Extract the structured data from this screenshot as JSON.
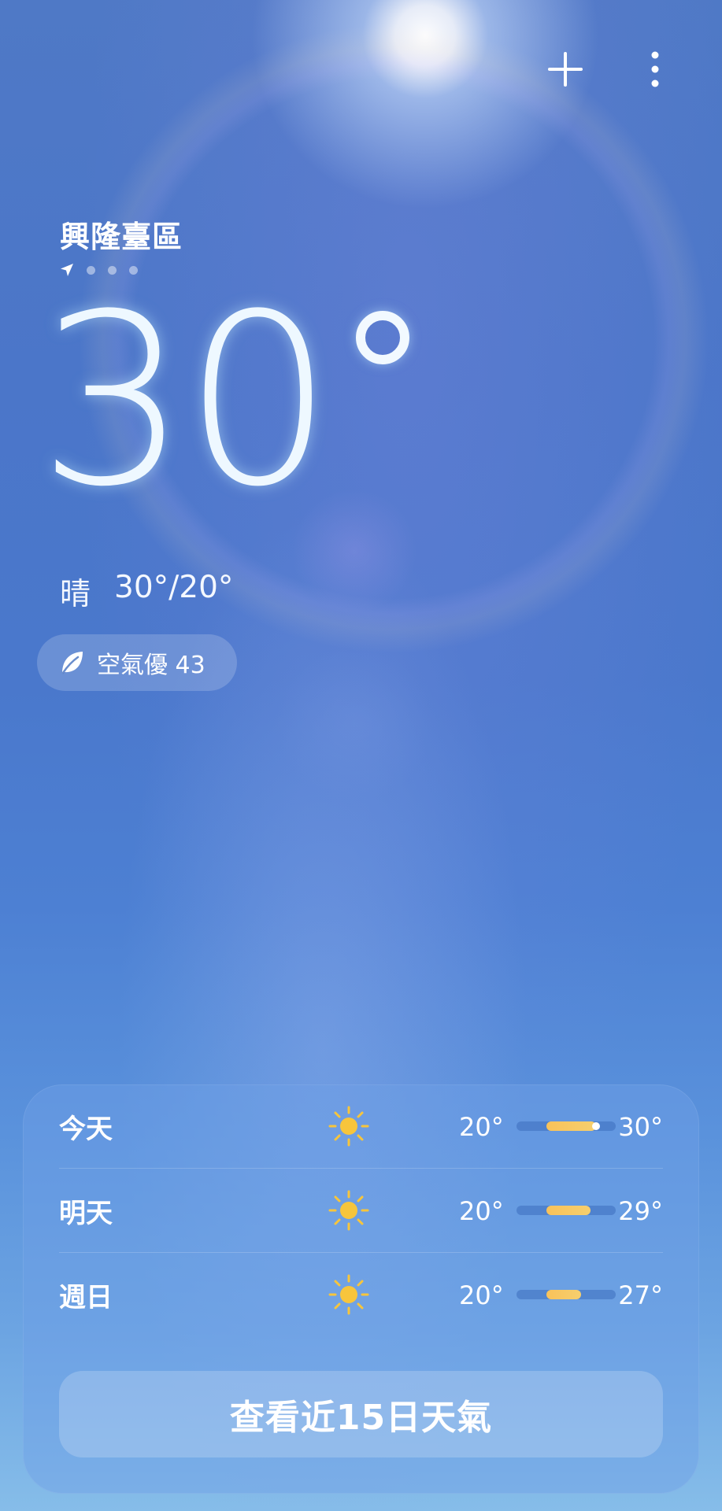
{
  "header": {
    "add_icon": "plus-icon",
    "more_icon": "more-vertical-icon"
  },
  "location": {
    "name": "興隆臺區",
    "indicator_icon": "location-arrow-icon",
    "page_count": 4,
    "current_page": 0
  },
  "current": {
    "temperature": "30",
    "condition": "晴",
    "high_low": "30°/20°"
  },
  "aqi": {
    "icon": "leaf-icon",
    "label": "空氣優 43"
  },
  "forecast": {
    "days": [
      {
        "day": "今天",
        "icon": "sun-icon",
        "low": "20°",
        "high": "30°",
        "low_value": 20,
        "high_value": 30,
        "current_value": 30
      },
      {
        "day": "明天",
        "icon": "sun-icon",
        "low": "20°",
        "high": "29°",
        "low_value": 20,
        "high_value": 29
      },
      {
        "day": "週日",
        "icon": "sun-icon",
        "low": "20°",
        "high": "27°",
        "low_value": 20,
        "high_value": 27
      }
    ],
    "button_label": "查看近15日天氣"
  },
  "colors": {
    "bar_fill": "#f8c25a",
    "sun": "#f7c53c",
    "sky_top": "#4f79c6",
    "sky_bottom": "#86bde9"
  }
}
